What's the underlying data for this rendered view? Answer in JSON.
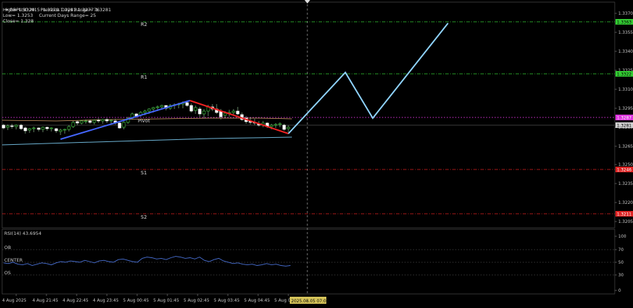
{
  "header": {
    "symbol_line": "GBPUSD,M15  1.3279 1.3281 1.3277 1.3281",
    "high_line": "High= 1.3329",
    "prev_range_line": "Previous Days Range= 76",
    "low_line": "Low= 1.3253",
    "curr_range_line": "Current Days Range= 25",
    "close_line": "Close= 1.328"
  },
  "levels": {
    "r2": "R2",
    "r1": "R1",
    "pivot": "Pivot",
    "s1": "S1",
    "s2": "S2"
  },
  "price_axis": {
    "ticks": [
      "1.3370",
      "1.3355",
      "1.3340",
      "1.3325",
      "1.3310",
      "1.3295",
      "1.3280",
      "1.3265",
      "1.3250",
      "1.3235",
      "1.3220",
      "1.3205"
    ],
    "badges": [
      {
        "label": "1.3363",
        "color": "#33cc33",
        "text_color": "#000000"
      },
      {
        "label": "1.3322",
        "color": "#33cc33",
        "text_color": "#000000"
      },
      {
        "label": "1.3287",
        "color": "#dd33dd",
        "text_color": "#ffffff"
      },
      {
        "label": "1.3281",
        "color": "#cfcfcf",
        "text_color": "#000000"
      },
      {
        "label": "1.3246",
        "color": "#dd2222",
        "text_color": "#ffffff"
      },
      {
        "label": "1.3211",
        "color": "#dd2222",
        "text_color": "#ffffff"
      }
    ]
  },
  "rsi": {
    "title": "RSI(14) 43.6954",
    "ob_label": "OB",
    "center_label": "CENTER",
    "os_label": "OS",
    "axis_ticks": [
      "100",
      "70",
      "50",
      "30",
      "0"
    ]
  },
  "time_axis": {
    "ticks": [
      "4 Aug 2025",
      "4 Aug 21:45",
      "4 Aug 22:45",
      "4 Aug 23:45",
      "5 Aug 00:45",
      "5 Aug 01:45",
      "5 Aug 02:45",
      "5 Aug 03:45",
      "5 Aug 04:45",
      "5 Aug 05:"
    ],
    "cursor_label": "2025.08.05 07:00"
  },
  "colors": {
    "background": "#000000",
    "r_line": "#33cc33",
    "s_line": "#dd2222",
    "pivot_line": "#dd33dd",
    "up_trend": "#4466ff",
    "down_trend": "#ee2222",
    "projection": "#8fd3ff",
    "rsi_line": "#4a72d8",
    "cursor_badge": "#d6c45a"
  }
}
